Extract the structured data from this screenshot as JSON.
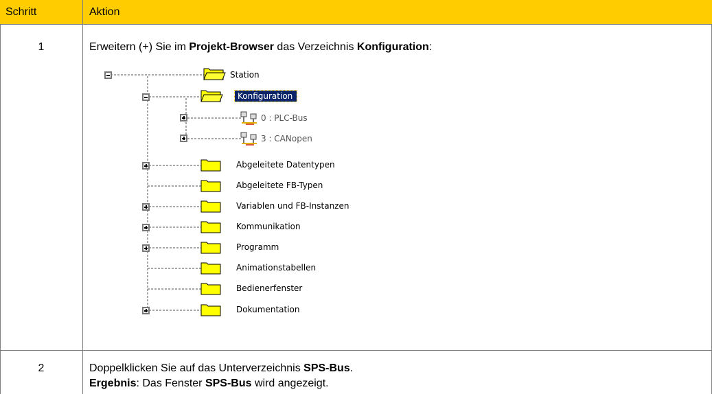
{
  "table": {
    "header": {
      "step": "Schritt",
      "action": "Aktion"
    },
    "rows": [
      {
        "step": "1",
        "text_parts": [
          "Erweitern (+) Sie im ",
          "Projekt-Browser",
          " das Verzeichnis ",
          "Konfiguration",
          ":"
        ]
      },
      {
        "step": "2",
        "line1_parts": [
          "Doppelklicken Sie auf das Unterverzeichnis ",
          "SPS-Bus",
          "."
        ],
        "line2_parts": [
          "Ergebnis",
          ": Das Fenster ",
          "SPS-Bus",
          " wird angezeigt."
        ]
      }
    ]
  },
  "tree": {
    "root": {
      "label": "Station",
      "expander": "minus",
      "icon": "folder-open-icon"
    },
    "configuration": {
      "label": "Konfiguration",
      "expander": "minus",
      "icon": "folder-open-icon",
      "selected": true
    },
    "buses": [
      {
        "label": "0 : PLC-Bus",
        "expander": "plus",
        "icon": "network-bus-icon"
      },
      {
        "label": "3 : CANopen",
        "expander": "plus",
        "icon": "network-bus-icon"
      }
    ],
    "folders": [
      {
        "label": "Abgeleitete Datentypen",
        "expander": "plus"
      },
      {
        "label": "Abgeleitete FB-Typen",
        "expander": "none"
      },
      {
        "label": "Variablen und FB-Instanzen",
        "expander": "plus"
      },
      {
        "label": "Kommunikation",
        "expander": "plus"
      },
      {
        "label": "Programm",
        "expander": "plus"
      },
      {
        "label": "Animationstabellen",
        "expander": "none"
      },
      {
        "label": "Bedienerfenster",
        "expander": "none"
      },
      {
        "label": "Dokumentation",
        "expander": "plus"
      }
    ]
  },
  "colors": {
    "header_background": "#ffcc00",
    "selection_background": "#0a246a",
    "folder_fill": "#ffff00",
    "grid_line": "#7f7f7f"
  }
}
